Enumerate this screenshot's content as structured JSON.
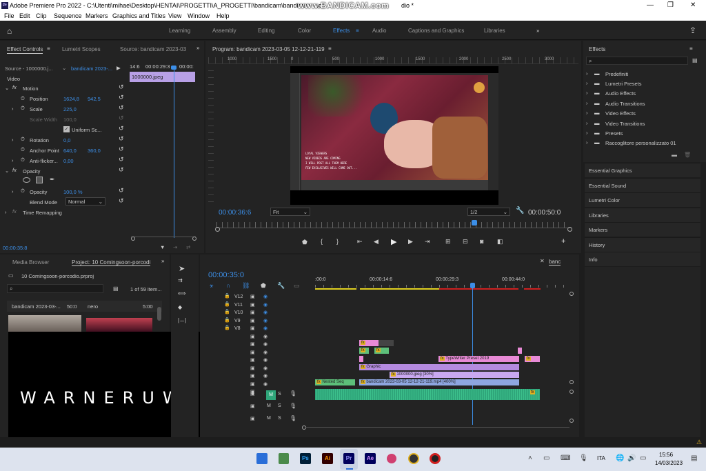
{
  "window": {
    "title": "Adobe Premiere Pro 2022 - C:\\Utenti\\mihae\\Desktop\\HENTAI\\PROGETTI\\A_PROGETTI\\bandicam\\bandicam - co",
    "title_suffix": "dio *",
    "watermark": "www.BANDICAM.com",
    "app_icon": "Pr"
  },
  "menu": [
    "File",
    "Edit",
    "Clip",
    "Sequence",
    "Markers",
    "Graphics and Titles",
    "View",
    "Window",
    "Help"
  ],
  "workspaces": [
    "Learning",
    "Assembly",
    "Editing",
    "Color",
    "Effects",
    "Audio",
    "Captions and Graphics",
    "Libraries"
  ],
  "workspace_active": "Effects",
  "effect_controls": {
    "tabs": [
      "Effect Controls",
      "Lumetri Scopes",
      "Source: bandicam 2023-03"
    ],
    "source": "Source - 1000000.j...",
    "sequence": "bandicam 2023-...",
    "mini_time_start": "14:6",
    "mini_time_mid": "00:00:29:3",
    "mini_time_end": "00:00:",
    "clip_name": "1000000.jpeg",
    "section_video": "Video",
    "motion": "Motion",
    "position_label": "Position",
    "position_x": "1624,8",
    "position_y": "942,5",
    "scale_label": "Scale",
    "scale_val": "225,0",
    "scale_width_label": "Scale Width",
    "scale_width_val": "100,0",
    "uniform_scale": "Uniform Sc...",
    "rotation_label": "Rotation",
    "rotation_val": "0,0",
    "anchor_label": "Anchor Point",
    "anchor_x": "640,0",
    "anchor_y": "360,0",
    "antiflicker_label": "Anti-flicker...",
    "antiflicker_val": "0,00",
    "opacity_section": "Opacity",
    "opacity_label": "Opacity",
    "opacity_val": "100,0 %",
    "blend_label": "Blend Mode",
    "blend_val": "Normal",
    "time_remap": "Time Remapping",
    "timecode": "00:00:35:8"
  },
  "program": {
    "title": "Program: bandicam 2023-03-05 12-12-21-119",
    "ruler": [
      "1000",
      "1500",
      "0",
      "500",
      "1000",
      "1500",
      "2000",
      "2500",
      "3000"
    ],
    "timecode_left": "00:00:36:6",
    "fit": "Fit",
    "resolution": "1/2",
    "timecode_right": "00:00:50:0",
    "overlay_lines": [
      "LOYAL VIEWERS",
      "NEW VIDEOS ARE COMING",
      "I WILL POST ALL THEM HERE",
      "FEW EXCLUSIVES WILL COME OUT..."
    ]
  },
  "effects_panel": {
    "title": "Effects",
    "folders": [
      "Predefiniti",
      "Lumetri Presets",
      "Audio Effects",
      "Audio Transitions",
      "Video Effects",
      "Video Transitions",
      "Presets",
      "Raccoglitore personalizzato 01"
    ],
    "collapsed_panels": [
      "Essential Graphics",
      "Essential Sound",
      "Lumetri Color",
      "Libraries",
      "Markers",
      "History",
      "Info"
    ]
  },
  "project": {
    "tabs": [
      "Media Browser",
      "Project: 10 Comingsoon-porcodi"
    ],
    "file": "10 Comingsoon-porcodio.prproj",
    "count": "1 of 59 item...",
    "items": [
      {
        "name": "bandicam 2023-03-...",
        "dur": "50:0"
      },
      {
        "name": "nero",
        "dur": "5:00"
      }
    ]
  },
  "timeline": {
    "tab": "banc",
    "timecode": "00:00:35:0",
    "ruler": [
      ":00:0",
      "00:00:14:6",
      "00:00:29:3",
      "00:00:44:0"
    ],
    "video_tracks": [
      "V12",
      "V11",
      "V10",
      "V9",
      "V8"
    ],
    "clips": {
      "typewriter": "TypeWriter Preset 2019",
      "graphic": "Graphic",
      "jpeg": "1000000.jpeg [30%]",
      "nested": "Nested Seq",
      "main": "bandicam 2023-03-05 12-12-21-119.mp4 [400%]",
      "fx": "fx"
    },
    "audio_buttons": [
      "M",
      "S"
    ]
  },
  "overlay": {
    "text": "WARNERUWU"
  },
  "taskbar": {
    "language": "ITA",
    "time": "15:56",
    "date": "14/03/2023",
    "apps": [
      "Ps",
      "Ai",
      "Pr",
      "Ae"
    ]
  },
  "colors": {
    "accent": "#3c8fe8",
    "clip_pink": "#e88ad6",
    "clip_purple": "#b58be0",
    "clip_blue": "#8ea6e0",
    "clip_green": "#5dbf7a",
    "audio_green": "#2fa67a"
  }
}
